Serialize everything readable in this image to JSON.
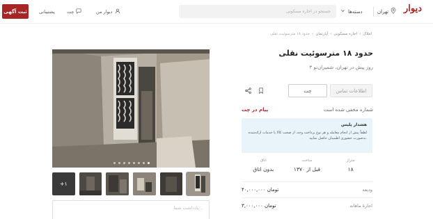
{
  "header": {
    "post_button": "ثبت آگهی",
    "support": "پشتیبانی",
    "chat": "چت",
    "my_divar": "دیوار من",
    "search_placeholder": "جستجو در اجاره مسکونی",
    "categories": "دسته‌ها",
    "city": "تهران",
    "logo": "دیوار"
  },
  "breadcrumb": [
    "املاک",
    "اجاره مسکونی",
    "آپارتمان",
    "حدود ۱۸ مترسوئیت نقلی"
  ],
  "ad": {
    "title": "حدود ۱۸ مترسوئیت نقلی",
    "subtitle": "۳ روز پیش در تهران، شمیران‌نو",
    "contact_button": "اطلاعات تماس",
    "chat_button": "چت",
    "hidden_number": "شماره مخفی شده است",
    "chat_message": "پیام در چت",
    "warning_title": "هشدار پلیس",
    "warning_text": "لطفاً پیش از انجام معامله و هر نوع پرداخت وجه، از صحت کالا یا خدمات ارائه‌شده به‌صورت حضوری اطمینان حاصل نمایید.",
    "stats": [
      {
        "label": "متراژ",
        "value": "۱۸"
      },
      {
        "label": "ساخت",
        "value": "قبل از ۱۳۷۰"
      },
      {
        "label": "اتاق",
        "value": "بدون اتاق"
      }
    ],
    "deposit_label": "ودیعه",
    "deposit_value": "۴۰,۰۰۰,۰۰۰ تومان",
    "rent_label": "اجارهٔ ماهانه",
    "rent_value": "۳,۰۰۰,۰۰۰ تومان",
    "more_images": "+۱",
    "note_placeholder": "یادداشت شما..."
  },
  "colors": {
    "brand": "#a62626",
    "warning_bg": "#e8f4fa"
  },
  "gallery": {
    "slide_count": 8,
    "active_slide": 8
  }
}
